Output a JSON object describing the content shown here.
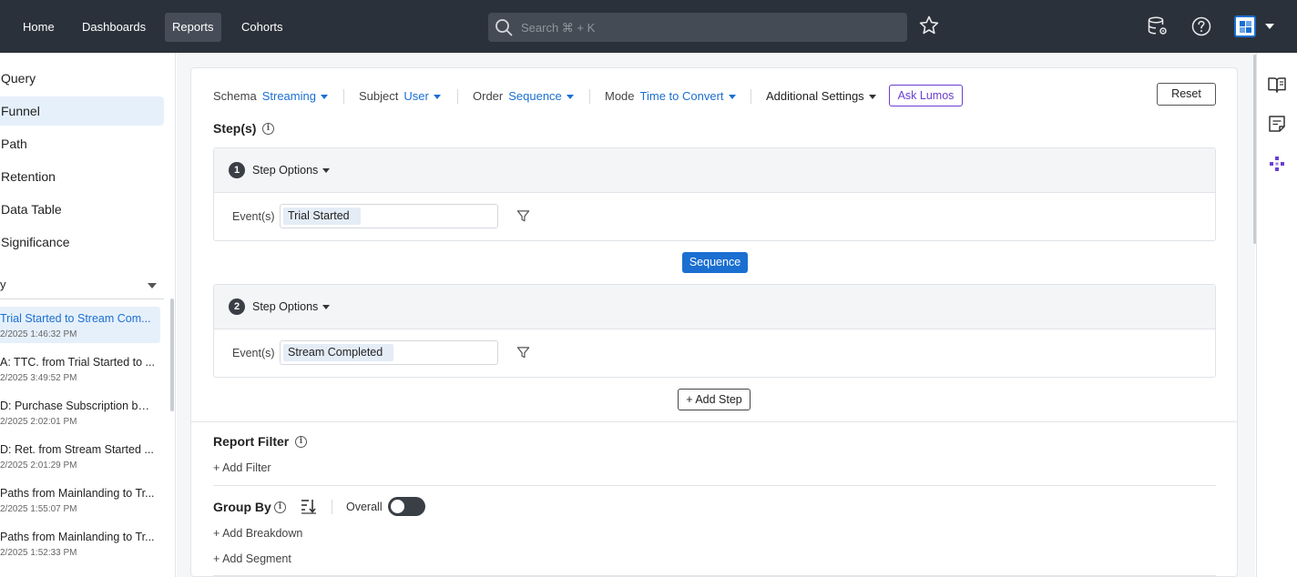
{
  "nav": {
    "items": [
      {
        "label": "Home"
      },
      {
        "label": "Dashboards"
      },
      {
        "label": "Reports"
      },
      {
        "label": "Cohorts"
      }
    ],
    "search_placeholder": "Search ⌘ + K"
  },
  "sidebar": {
    "report_types": [
      {
        "label": "Query"
      },
      {
        "label": "Funnel"
      },
      {
        "label": "Path"
      },
      {
        "label": "Retention"
      },
      {
        "label": "Data Table"
      },
      {
        "label": "Significance"
      }
    ],
    "select_value": "y",
    "saved_reports": [
      {
        "title": "Trial Started to Stream Com...",
        "date": "2/2025 1:46:32 PM"
      },
      {
        "title": "A: TTC. from Trial Started to ...",
        "date": "2/2025 3:49:52 PM"
      },
      {
        "title": "D: Purchase Subscription by ...",
        "date": "2/2025 2:02:01 PM"
      },
      {
        "title": "D: Ret. from Stream Started ...",
        "date": "2/2025 2:01:29 PM"
      },
      {
        "title": "Paths from Mainlanding to Tr...",
        "date": "2/2025 1:55:07 PM"
      },
      {
        "title": "Paths from Mainlanding to Tr...",
        "date": "2/2025 1:52:33 PM"
      }
    ]
  },
  "settings": {
    "schema_label": "Schema",
    "schema_value": "Streaming",
    "subject_label": "Subject",
    "subject_value": "User",
    "order_label": "Order",
    "order_value": "Sequence",
    "mode_label": "Mode",
    "mode_value": "Time to Convert",
    "additional": "Additional Settings",
    "ask": "Ask Lumos",
    "reset": "Reset"
  },
  "steps_title": "Step(s)",
  "steps": [
    {
      "number": "1",
      "options": "Step Options",
      "events_label": "Event(s)",
      "event": "Trial Started"
    },
    {
      "number": "2",
      "options": "Step Options",
      "events_label": "Event(s)",
      "event": "Stream Completed"
    }
  ],
  "sequence_label": "Sequence",
  "add_step": "+ Add Step",
  "report_filter": {
    "title": "Report Filter",
    "add": "+ Add Filter"
  },
  "group_by": {
    "title": "Group By",
    "overall": "Overall",
    "add_breakdown": "+ Add Breakdown",
    "add_segment": "+ Add Segment"
  },
  "colors": {
    "nav_bg": "#2b313a",
    "accent": "#1b6fd1",
    "lumos": "#6a3fd0"
  },
  "icons": [
    "search-icon",
    "star-icon",
    "database-settings-icon",
    "help-icon",
    "app-switcher-icon",
    "book-icon",
    "notes-icon",
    "sparkle-icon",
    "filter-icon",
    "info-icon",
    "sort-icon"
  ]
}
